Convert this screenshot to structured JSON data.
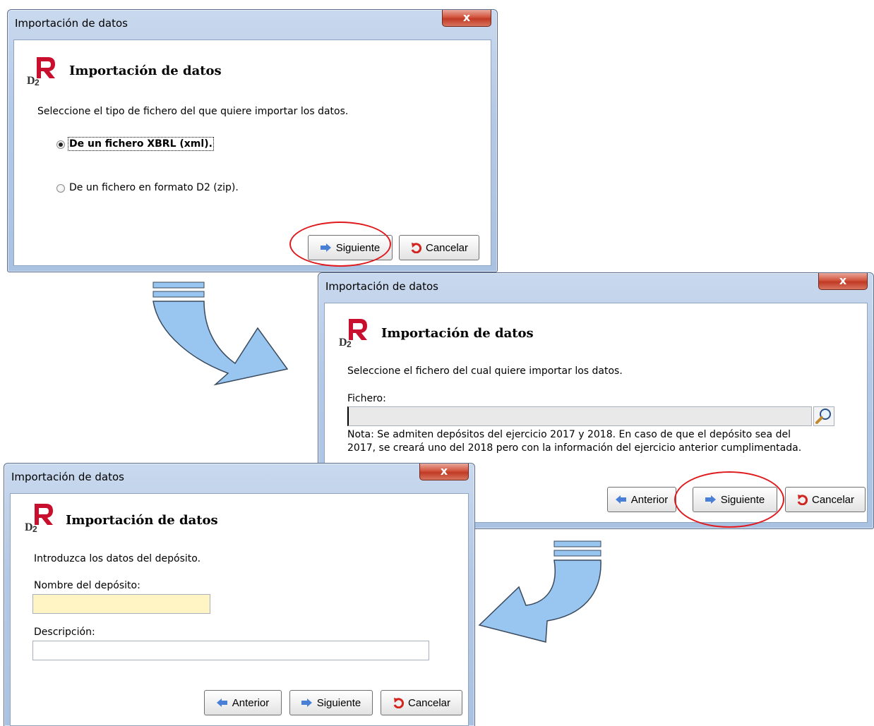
{
  "common": {
    "window_title": "Importación de datos",
    "close_glyph": "x",
    "header_title": "Importación de datos",
    "logo_text": "D2",
    "colors": {
      "arrow_fill": "#99c6f0",
      "arrow_stroke": "#3a4a5c",
      "highlight": "#e0191d",
      "required_field": "#fff5c4"
    }
  },
  "dialog1": {
    "instruction": "Seleccione el tipo de fichero del que quiere importar los datos.",
    "options": [
      {
        "label": "De un fichero XBRL (xml).",
        "selected": true
      },
      {
        "label": "De un fichero en formato D2 (zip).",
        "selected": false
      }
    ],
    "next_label": "Siguiente",
    "cancel_label": "Cancelar"
  },
  "dialog2": {
    "instruction": "Seleccione el fichero del cual quiere importar los datos.",
    "file_label": "Fichero:",
    "file_value": "",
    "note_line1": "Nota: Se admiten depósitos del ejercicio 2017 y 2018. En caso de que el depósito sea del",
    "note_line2": "2017, se creará uno del 2018 pero con la información del ejercicio anterior cumplimentada.",
    "back_label": "Anterior",
    "next_label": "Siguiente",
    "cancel_label": "Cancelar"
  },
  "dialog3": {
    "instruction": "Introduzca los datos del depósito.",
    "name_label": "Nombre del depósito:",
    "name_value": "",
    "desc_label": "Descripción:",
    "desc_value": "",
    "back_label": "Anterior",
    "next_label": "Siguiente",
    "cancel_label": "Cancelar"
  }
}
